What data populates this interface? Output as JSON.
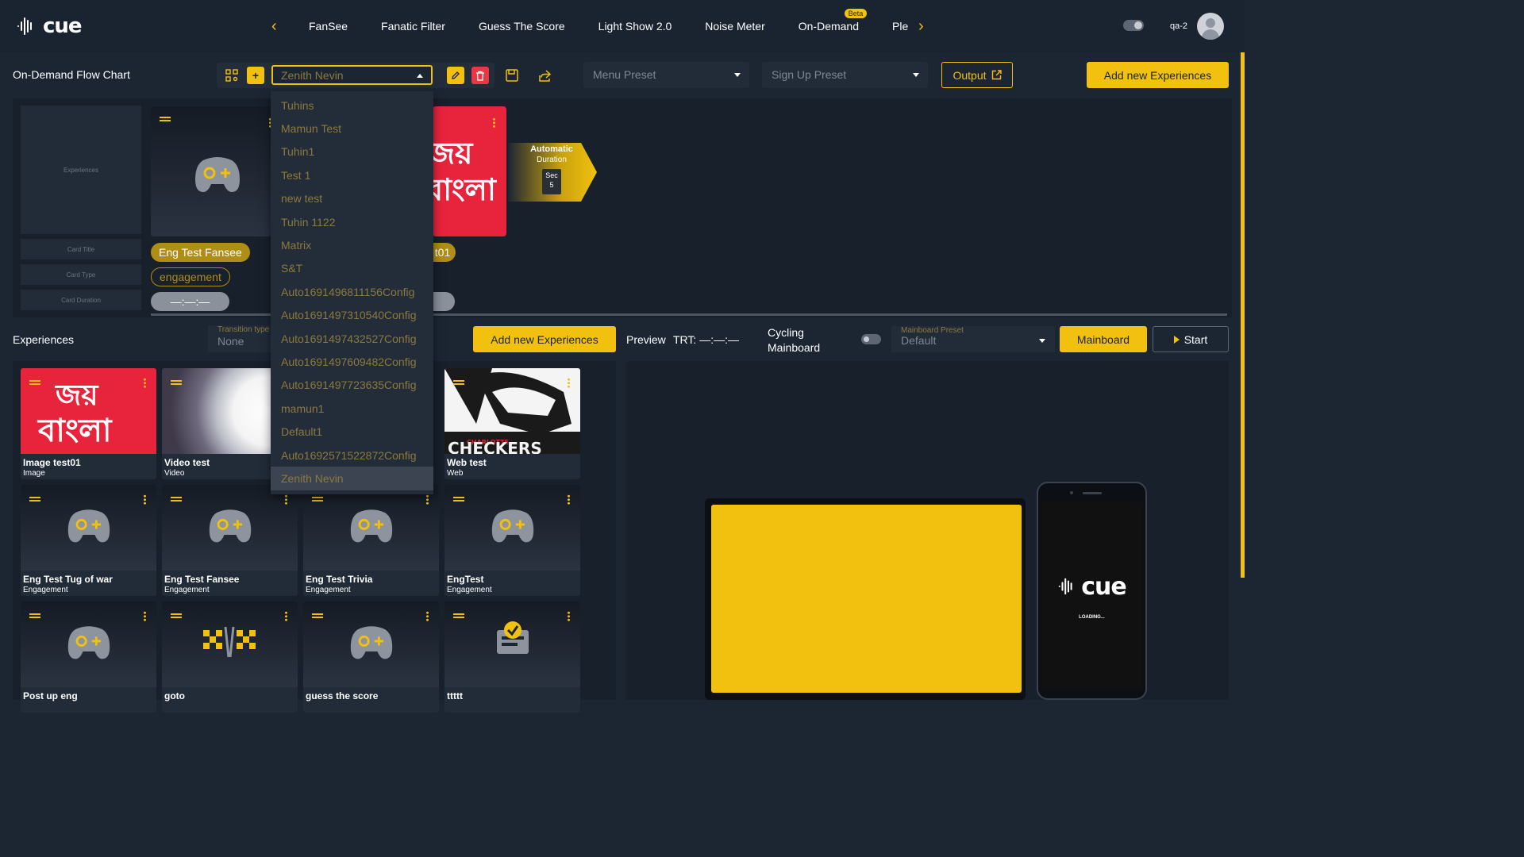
{
  "app": {
    "logo_text": "cue"
  },
  "nav": {
    "items": [
      {
        "label": "FanSee"
      },
      {
        "label": "Fanatic Filter"
      },
      {
        "label": "Guess The Score"
      },
      {
        "label": "Light Show 2.0"
      },
      {
        "label": "Noise Meter"
      },
      {
        "label": "On-Demand",
        "badge": "Beta"
      },
      {
        "label": "Plec"
      }
    ],
    "user": "qa-2"
  },
  "toolbar": {
    "page_title": "On-Demand Flow Chart",
    "config_select": "Zenith Nevin",
    "menu_preset": "Menu Preset",
    "signup_preset": "Sign Up Preset",
    "output_label": "Output",
    "add_new_label": "Add new Experiences"
  },
  "dropdown": {
    "options": [
      "Tuhins",
      "Mamun Test",
      "Tuhin1",
      "Test 1",
      "new test",
      "Tuhin 1122",
      "Matrix",
      "S&T",
      "Auto1691496811156Config",
      "Auto1691497310540Config",
      "Auto1691497432527Config",
      "Auto1691497609482Config",
      "Auto1691497723635Config",
      "mamun1",
      "Default1",
      "Auto1692571522872Config",
      "Zenith Nevin"
    ],
    "selected": "Zenith Nevin"
  },
  "flow": {
    "labels": {
      "experiences": "Experiences",
      "card_title": "Card Title",
      "card_type": "Card Type",
      "card_duration": "Card Duration"
    },
    "card1": {
      "title": "Eng Test Fansee",
      "type": "engagement",
      "duration": "—:—:—"
    },
    "card2": {
      "title_partial": "t01"
    },
    "automatic": {
      "title": "Automatic",
      "sub": "Duration",
      "unit": "Sec",
      "value": "5"
    }
  },
  "experiences": {
    "title": "Experiences",
    "transition_label": "Transition type",
    "transition_value": "None",
    "add_new_label": "Add new Experiences",
    "tiles": [
      {
        "title": "Image test01",
        "type": "Image"
      },
      {
        "title": "Video test",
        "type": "Video"
      },
      {
        "title": "Web test",
        "type": "Web"
      },
      {
        "title": "Eng Test Tug of war",
        "type": "Engagement"
      },
      {
        "title": "Eng Test Fansee",
        "type": "Engagement"
      },
      {
        "title": "Eng Test Trivia",
        "type": "Engagement"
      },
      {
        "title": "EngTest",
        "type": "Engagement"
      },
      {
        "title": "Post up eng",
        "type": ""
      },
      {
        "title": "goto",
        "type": ""
      },
      {
        "title": "guess the score",
        "type": ""
      },
      {
        "title": "ttttt",
        "type": ""
      }
    ]
  },
  "preview": {
    "title": "Preview",
    "trt": "TRT: —:—:—",
    "cycling_line1": "Cycling",
    "cycling_line2": "Mainboard",
    "mainboard_preset_label": "Mainboard Preset",
    "mainboard_preset_value": "Default",
    "mainboard_label": "Mainboard",
    "start_label": "Start",
    "phone_logo": "cue",
    "phone_loading": "LOADING..."
  },
  "colors": {
    "accent": "#f2c10f",
    "bg": "#1c2633",
    "danger": "#e63946"
  }
}
